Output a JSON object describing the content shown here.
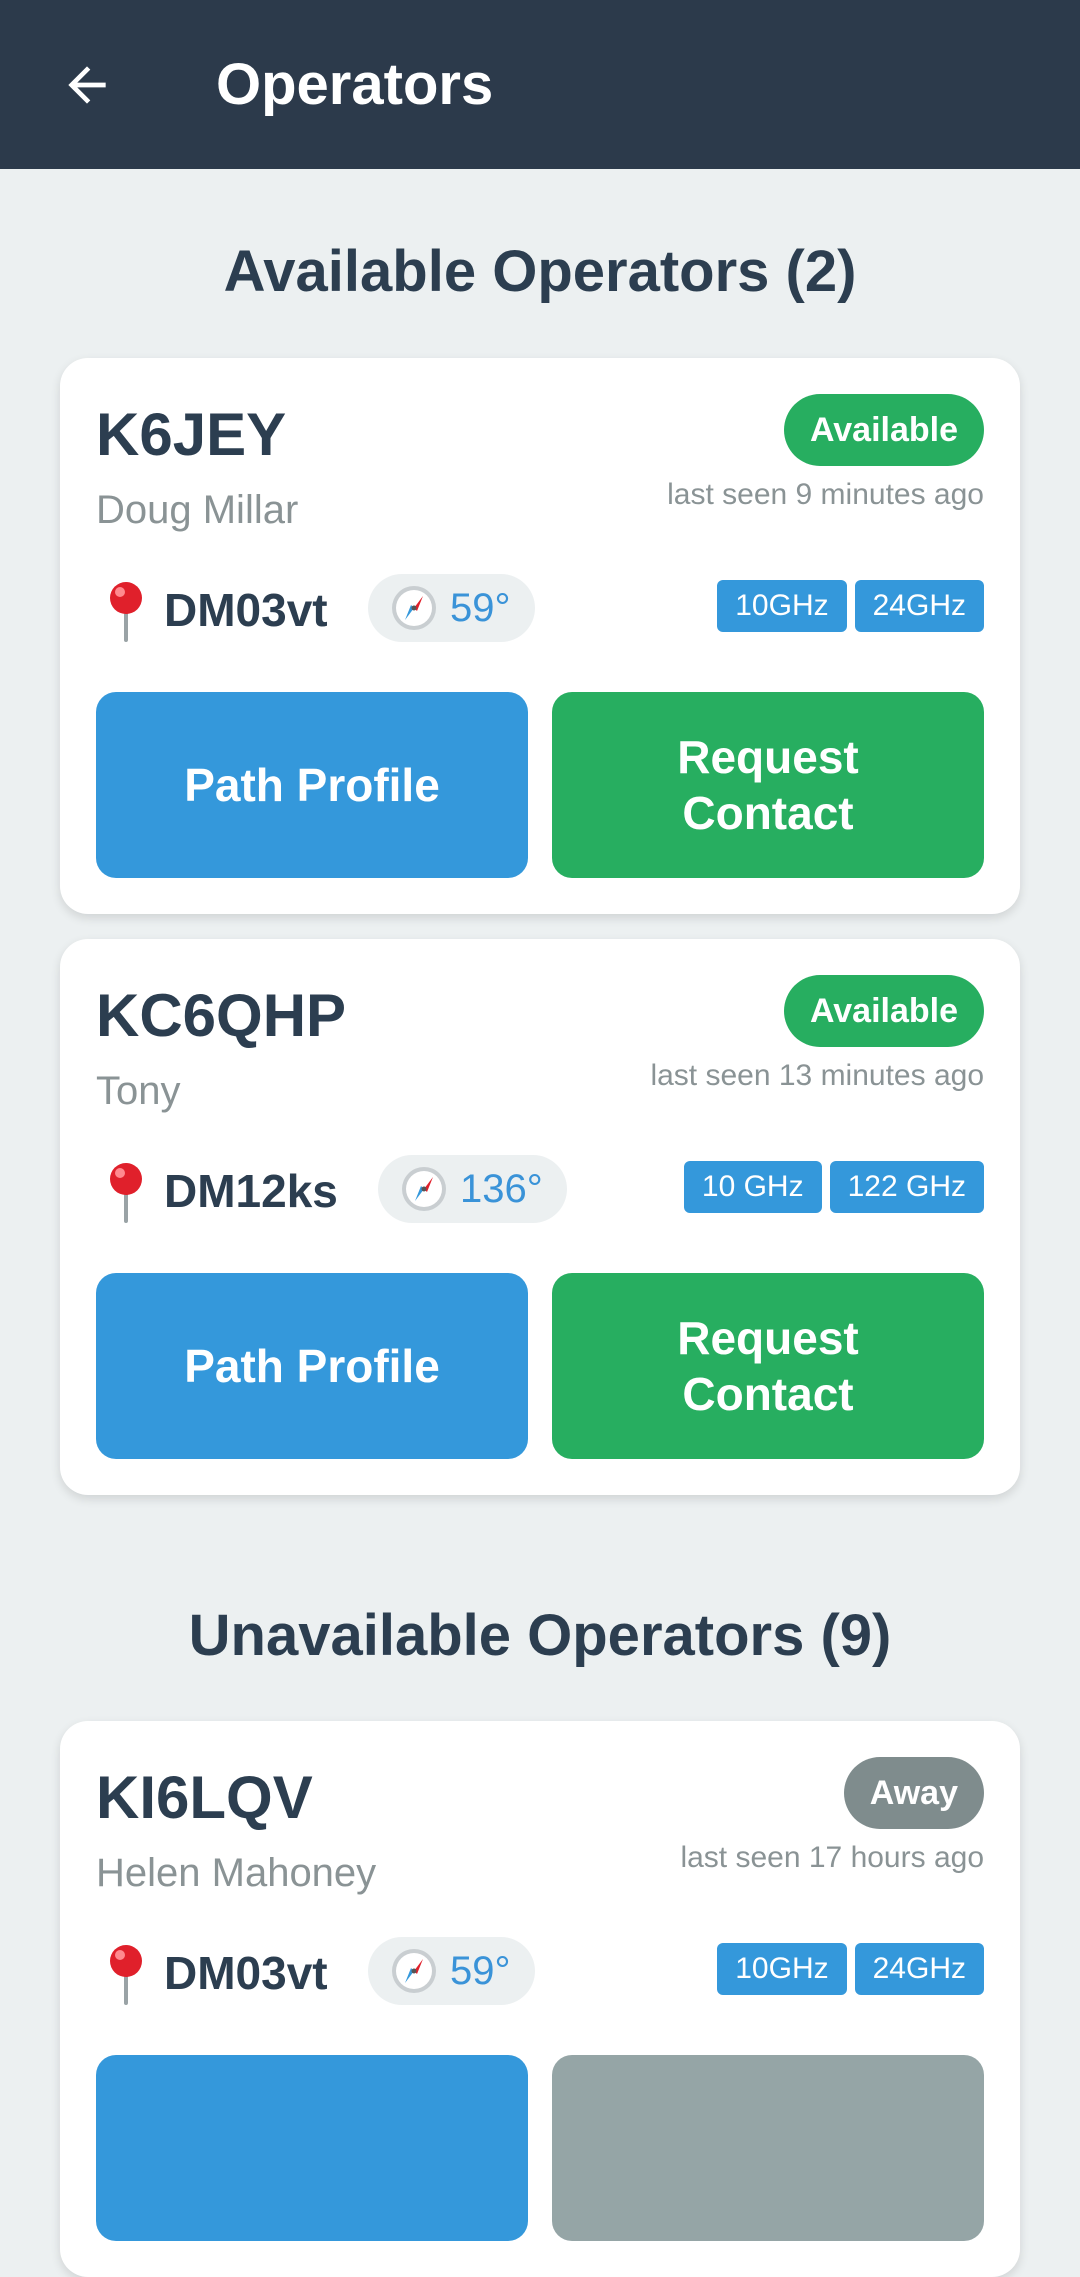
{
  "appbar": {
    "title": "Operators"
  },
  "sections": {
    "available_title": "Available Operators (2)",
    "unavailable_title": "Unavailable Operators (9)"
  },
  "available": [
    {
      "callsign": "K6JEY",
      "name": "Doug Millar",
      "status": "Available",
      "last_seen": "last seen 9 minutes ago",
      "grid": "DM03vt",
      "bearing": "59°",
      "bands": [
        "10GHz",
        "24GHz"
      ],
      "path_label": "Path Profile",
      "request_label": "Request\nContact"
    },
    {
      "callsign": "KC6QHP",
      "name": "Tony",
      "status": "Available",
      "last_seen": "last seen 13 minutes ago",
      "grid": "DM12ks",
      "bearing": "136°",
      "bands": [
        "10 GHz",
        "122 GHz"
      ],
      "path_label": "Path Profile",
      "request_label": "Request\nContact"
    }
  ],
  "unavailable": [
    {
      "callsign": "KI6LQV",
      "name": "Helen Mahoney",
      "status": "Away",
      "last_seen": "last seen 17 hours ago",
      "grid": "DM03vt",
      "bearing": "59°",
      "bands": [
        "10GHz",
        "24GHz"
      ]
    }
  ],
  "colors": {
    "appbar": "#2c3a4b",
    "available": "#27ae60",
    "away": "#7f8c8d",
    "accent": "#3498db"
  },
  "icons": {
    "back": "arrow-left-icon",
    "location": "pin-icon",
    "bearing": "compass-icon"
  }
}
